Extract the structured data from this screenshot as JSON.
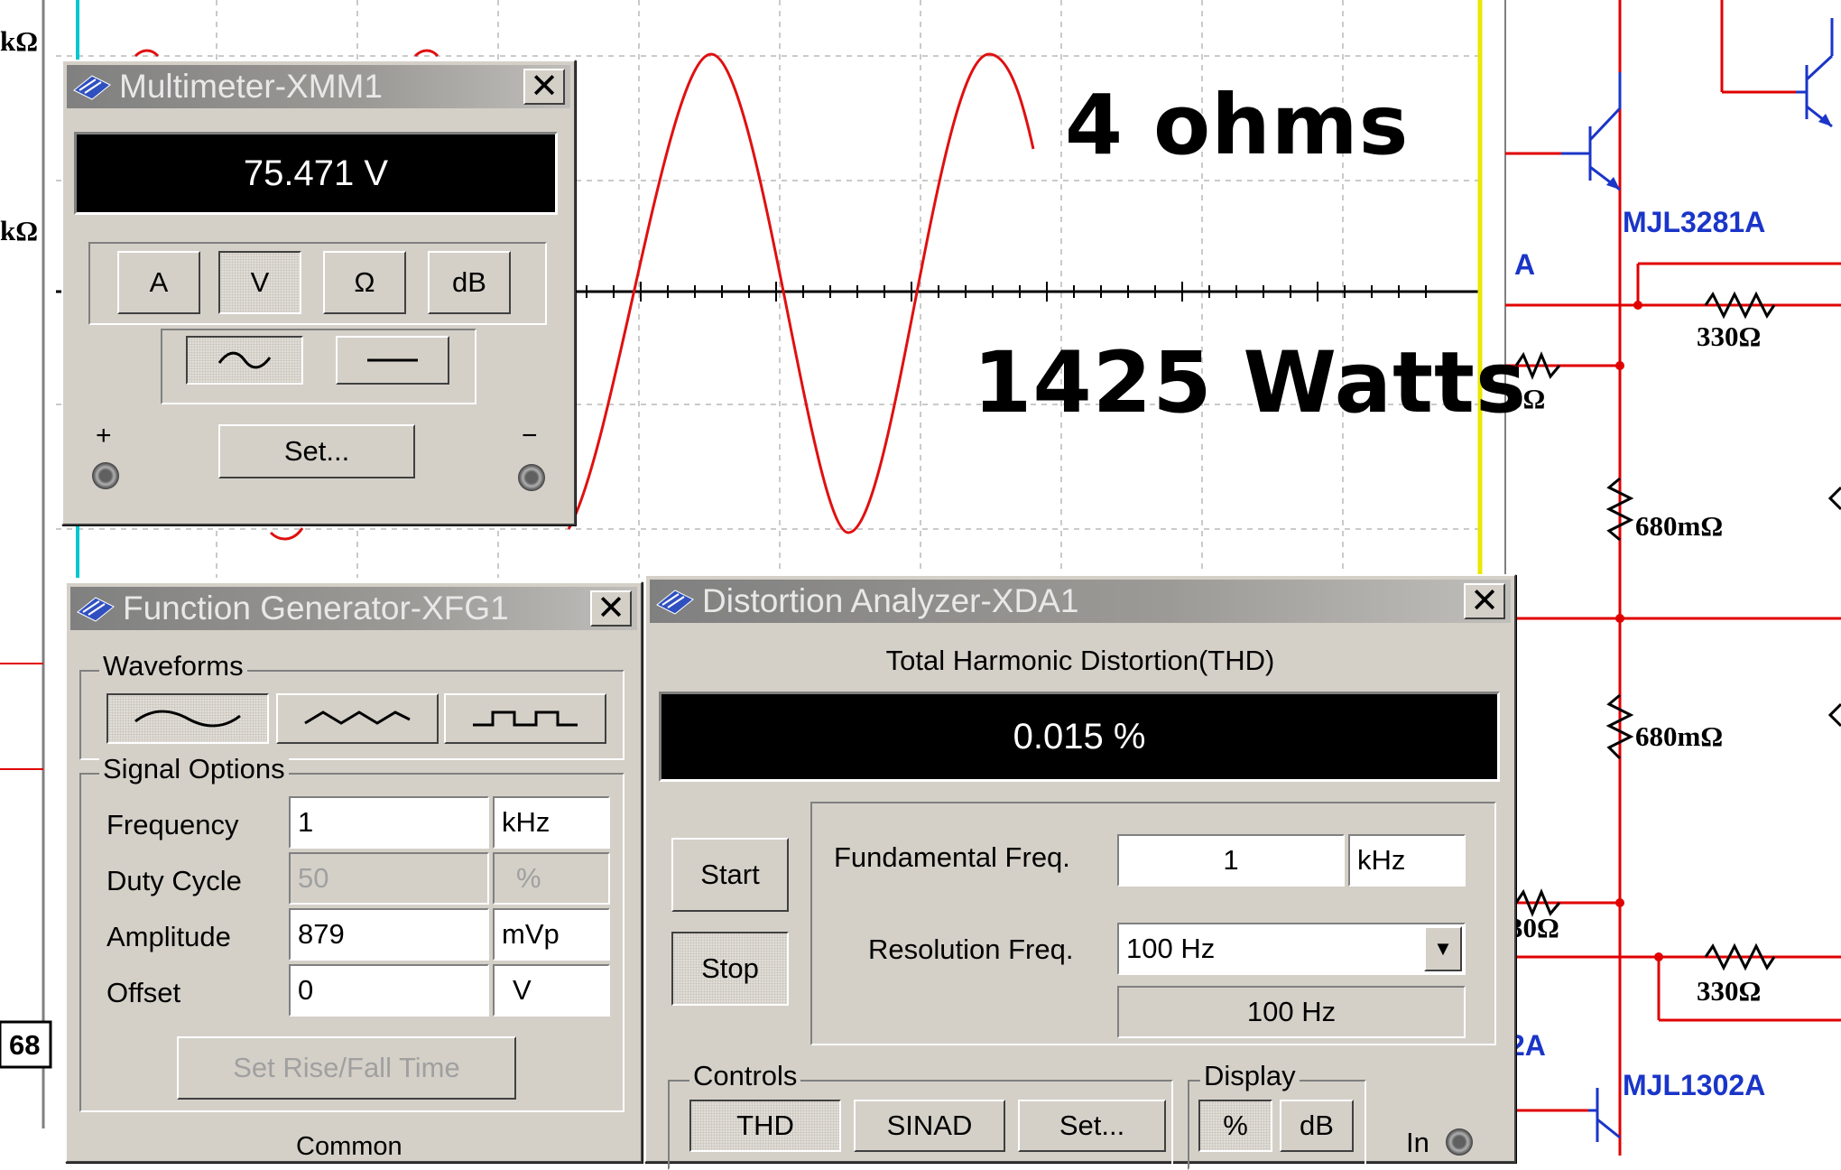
{
  "overlay": {
    "load_label": "4 ohms",
    "power_label": "1425 Watts"
  },
  "schematic": {
    "transistors": [
      "MJL3281A",
      "MJL1302A"
    ],
    "partial_labels": [
      "A",
      "2A"
    ],
    "resistors": [
      "330Ω",
      "680mΩ",
      "680mΩ",
      "330Ω"
    ],
    "partial_resistors": [
      "kΩ",
      "kΩ",
      "0Ω",
      "30Ω"
    ],
    "left_box_value": "68"
  },
  "multimeter": {
    "title": "Multimeter-XMM1",
    "reading": "75.471 V",
    "modes": [
      "A",
      "V",
      "Ω",
      "dB"
    ],
    "active_mode": "V",
    "set_label": "Set...",
    "plus_label": "+",
    "minus_label": "−"
  },
  "function_generator": {
    "title": "Function Generator-XFG1",
    "waveforms_label": "Waveforms",
    "signal_options_label": "Signal Options",
    "fields": [
      {
        "label": "Frequency",
        "value": "1",
        "unit": "kHz",
        "disabled": false
      },
      {
        "label": "Duty Cycle",
        "value": "50",
        "unit": "%",
        "disabled": true
      },
      {
        "label": "Amplitude",
        "value": "879",
        "unit": "mVp",
        "disabled": false
      },
      {
        "label": "Offset",
        "value": "0",
        "unit": "V",
        "disabled": false
      }
    ],
    "rise_fall_label": "Set Rise/Fall Time",
    "common_label": "Common"
  },
  "distortion_analyzer": {
    "title": "Distortion Analyzer-XDA1",
    "thd_heading": "Total Harmonic Distortion(THD)",
    "reading": "0.015 %",
    "start_label": "Start",
    "stop_label": "Stop",
    "fundamental_label": "Fundamental Freq.",
    "fundamental_value": "1",
    "fundamental_unit": "kHz",
    "resolution_label": "Resolution Freq.",
    "resolution_value": "100 Hz",
    "resolution_readout": "100 Hz",
    "controls_label": "Controls",
    "controls": [
      "THD",
      "SINAD",
      "Set..."
    ],
    "display_label": "Display",
    "display_modes": [
      "%",
      "dB"
    ],
    "in_label": "In"
  },
  "colors": {
    "trace": "#e01010",
    "wire": "#e00000",
    "transistor": "#1a35c8",
    "window_bg": "#d4d0c8"
  }
}
